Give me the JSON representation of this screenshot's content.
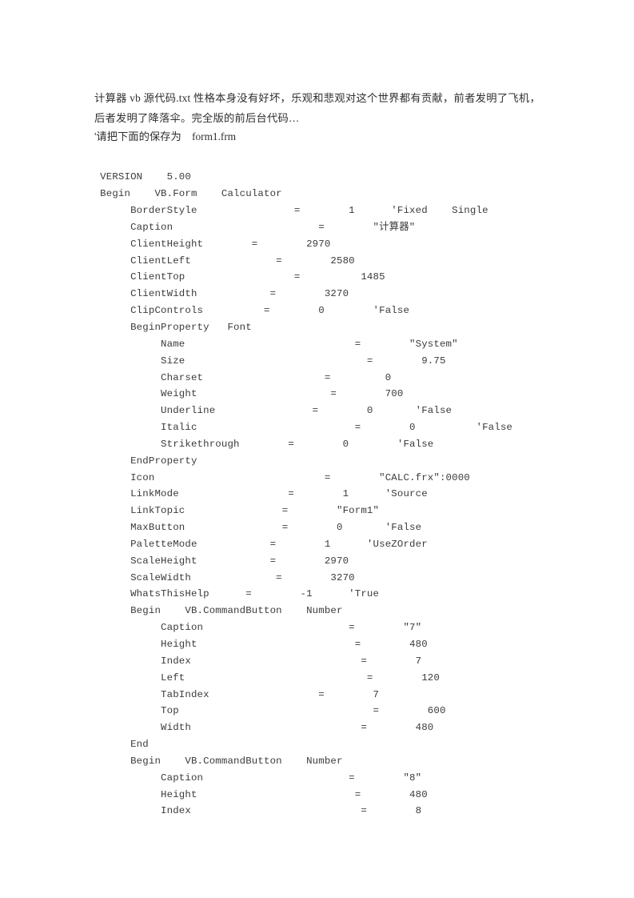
{
  "document": {
    "intro_paragraph": "计算器 vb 源代码.txt 性格本身没有好坏，乐观和悲观对这个世界都有贡献，前者发明了飞机，后者发明了降落伞。完全版的前后台代码…",
    "save_note": "'请把下面的保存为    form1.frm",
    "code_lines": [
      "  VERSION    5.00",
      "  Begin    VB.Form    Calculator",
      "       BorderStyle                =        1      'Fixed    Single",
      "       Caption                        =        \"计算器\"",
      "       ClientHeight        =        2970",
      "       ClientLeft              =        2580",
      "       ClientTop                  =          1485",
      "       ClientWidth            =        3270",
      "       ClipControls          =        0        'False",
      "       BeginProperty   Font",
      "            Name                            =        \"System\"",
      "            Size                              =        9.75",
      "            Charset                    =         0",
      "            Weight                      =        700",
      "            Underline                =        0       'False",
      "            Italic                          =        0          'False",
      "            Strikethrough        =        0        'False",
      "       EndProperty",
      "       Icon                            =        \"CALC.frx\":0000",
      "       LinkMode                  =        1      'Source",
      "       LinkTopic                =        \"Form1\"",
      "       MaxButton                =        0       'False",
      "       PaletteMode            =        1      'UseZOrder",
      "       ScaleHeight            =        2970",
      "       ScaleWidth              =        3270",
      "       WhatsThisHelp      =        -1      'True",
      "       Begin    VB.CommandButton    Number",
      "            Caption                        =        \"7\"",
      "            Height                          =        480",
      "            Index                            =        7",
      "            Left                              =        120",
      "            TabIndex                  =        7",
      "            Top                                =        600",
      "            Width                            =        480",
      "       End",
      "       Begin    VB.CommandButton    Number",
      "            Caption                        =        \"8\"",
      "            Height                          =        480",
      "            Index                            =        8"
    ]
  }
}
